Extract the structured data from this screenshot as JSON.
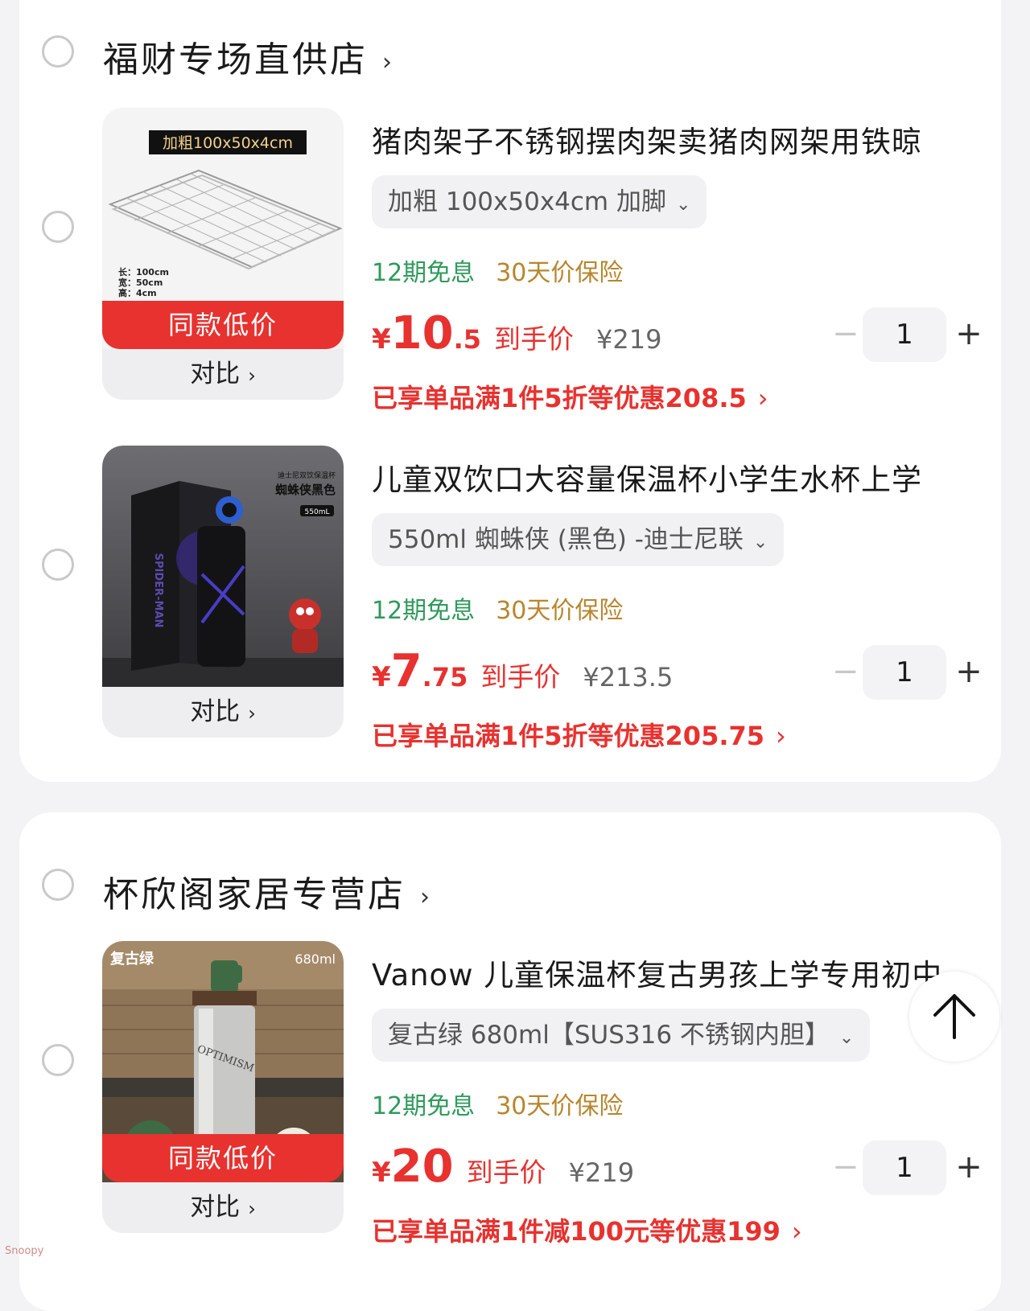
{
  "shops": [
    {
      "name": "福财专场直供店",
      "items": [
        {
          "title": "猪肉架子不锈钢摆肉架卖猪肉网架用铁晾",
          "variant": "加粗 100x50x4cm 加脚",
          "tag_green": "12期免息",
          "tag_gold": "30天价保险",
          "price_yen": "¥",
          "price_int": "10",
          "price_dec": ".5",
          "price_label": "到手价",
          "orig_price": "¥219",
          "qty": "1",
          "promo": "已享单品满1件5折等优惠208.5",
          "deal_label": "同款低价",
          "compare_label": "对比",
          "image_text": "加粗100x50x4cm",
          "dims": [
            "长：100cm",
            "宽：50cm",
            "高：4cm"
          ]
        },
        {
          "title": "儿童双饮口大容量保温杯小学生水杯上学",
          "variant": "550ml 蜘蛛侠 (黑色)  -迪士尼联",
          "tag_green": "12期免息",
          "tag_gold": "30天价保险",
          "price_yen": "¥",
          "price_int": "7",
          "price_dec": ".75",
          "price_label": "到手价",
          "orig_price": "¥213.5",
          "qty": "1",
          "promo": "已享单品满1件5折等优惠205.75",
          "compare_label": "对比",
          "image_text": "蜘蛛侠黑色",
          "image_small": "迪士尼双饮保温杯",
          "image_badge": "550mL",
          "box_text": "SPIDER-MAN"
        }
      ]
    },
    {
      "name": "杯欣阁家居专营店",
      "items": [
        {
          "title": "Vanow 儿童保温杯复古男孩上学专用初中",
          "variant": "复古绿 680ml【SUS316 不锈钢内胆】",
          "tag_green": "12期免息",
          "tag_gold": "30天价保险",
          "price_yen": "¥",
          "price_int": "20",
          "price_dec": "",
          "price_label": "到手价",
          "orig_price": "¥219",
          "qty": "1",
          "promo": "已享单品满1件减100元等优惠199",
          "deal_label": "同款低价",
          "compare_label": "对比",
          "image_left": "复古绿",
          "image_right": "680ml",
          "bottle_text": "OPTIMISM"
        }
      ]
    }
  ],
  "ui": {
    "chevron": "›",
    "select_chevron": "⌄",
    "minus": "−",
    "plus": "+",
    "watermark": "Snoopy"
  }
}
